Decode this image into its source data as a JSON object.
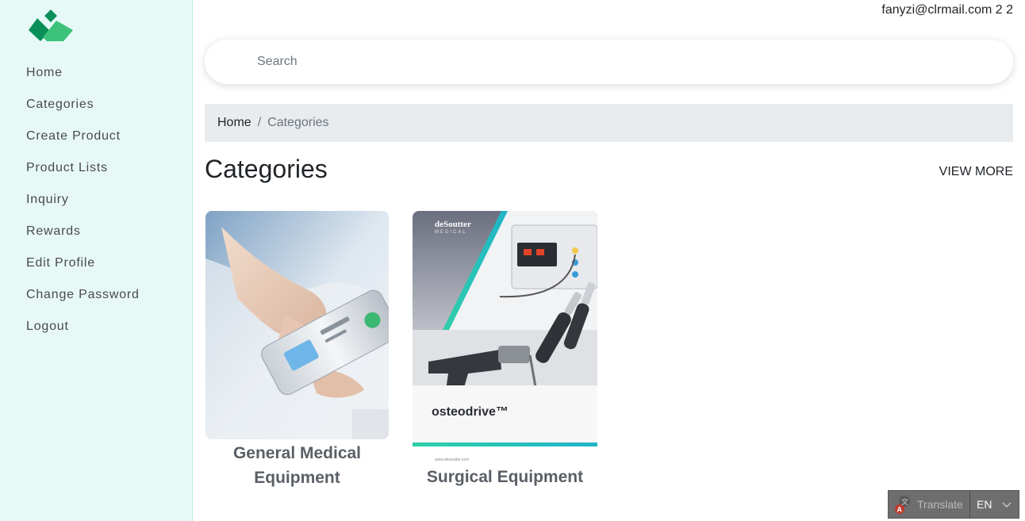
{
  "sidebar": {
    "logo": "brand-logo",
    "items": [
      {
        "label": "Home"
      },
      {
        "label": "Categories"
      },
      {
        "label": "Create Product"
      },
      {
        "label": "Product Lists"
      },
      {
        "label": "Inquiry"
      },
      {
        "label": "Rewards"
      },
      {
        "label": "Edit Profile"
      },
      {
        "label": "Change Password"
      },
      {
        "label": "Logout"
      }
    ]
  },
  "header": {
    "user_email": "fanyzi@clrmail.com 2 2"
  },
  "search": {
    "placeholder": "Search"
  },
  "breadcrumb": {
    "home": "Home",
    "separator": "/",
    "current": "Categories"
  },
  "section": {
    "title": "Categories",
    "view_more": "VIEW MORE"
  },
  "categories": [
    {
      "label": "General Medical Equipment",
      "image": "handheld-medical-device-photo"
    },
    {
      "label": "Surgical Equipment",
      "image": "desoutter-osteodrive-brochure",
      "brand_text": "deSoutter",
      "brand_sub": "MEDICAL",
      "product_text": "osteodrive™",
      "footer_url": "www.desoutter.com"
    }
  ],
  "translate_widget": {
    "label": "Translate",
    "language": "EN"
  },
  "colors": {
    "sidebar_bg": "#e6f9f6",
    "logo_dark": "#0a8f5b",
    "logo_light": "#3cc27a",
    "accent_teal": "#2fcfa8"
  }
}
